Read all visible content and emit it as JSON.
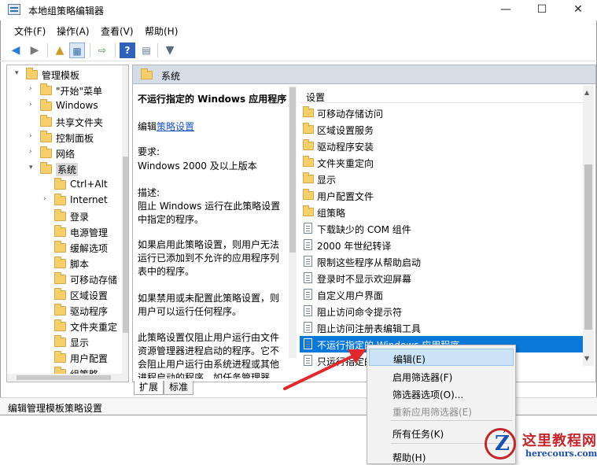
{
  "window": {
    "title": "本地组策略编辑器",
    "minimize_glyph": "—",
    "maximize_glyph": "☐",
    "close_glyph": "✕"
  },
  "menubar": [
    "文件(F)",
    "操作(A)",
    "查看(V)",
    "帮助(H)"
  ],
  "toolbar": {
    "icons": [
      "back-arrow-icon",
      "forward-arrow-icon",
      "up-folder-icon",
      "show-hide-tree-icon",
      "export-list-icon",
      "help-icon",
      "properties-icon",
      "filter-icon"
    ]
  },
  "tree": {
    "items": [
      {
        "label": "管理模板",
        "expand": "▾",
        "selected": false
      },
      {
        "label": "\"开始\"菜单",
        "expand": "›",
        "selected": false
      },
      {
        "label": "Windows",
        "expand": "›",
        "selected": false
      },
      {
        "label": "共享文件夹",
        "expand": "",
        "selected": false
      },
      {
        "label": "控制面板",
        "expand": "›",
        "selected": false
      },
      {
        "label": "网络",
        "expand": "›",
        "selected": false
      },
      {
        "label": "系统",
        "expand": "▾",
        "selected": true
      },
      {
        "label": "Ctrl+Alt",
        "expand": "",
        "selected": false
      },
      {
        "label": "Internet",
        "expand": "›",
        "selected": false
      },
      {
        "label": "登录",
        "expand": "",
        "selected": false
      },
      {
        "label": "电源管理",
        "expand": "",
        "selected": false
      },
      {
        "label": "缓解选项",
        "expand": "",
        "selected": false
      },
      {
        "label": "脚本",
        "expand": "",
        "selected": false
      },
      {
        "label": "可移动存储",
        "expand": "",
        "selected": false
      },
      {
        "label": "区域设置",
        "expand": "",
        "selected": false
      },
      {
        "label": "驱动程序",
        "expand": "",
        "selected": false
      },
      {
        "label": "文件夹重定向",
        "expand": "",
        "selected": false
      },
      {
        "label": "显示",
        "expand": "",
        "selected": false
      },
      {
        "label": "用户配置",
        "expand": "",
        "selected": false
      },
      {
        "label": "组策略",
        "expand": "",
        "selected": false
      }
    ]
  },
  "right": {
    "header": "系统",
    "desc": {
      "title": "不运行指定的 Windows 应用程序",
      "edit_prefix": "编辑",
      "edit_link": "策略设置",
      "req_label": "要求:",
      "req_value": "Windows 2000 及以上版本",
      "desc_label": "描述:",
      "desc_text": "阻止 Windows 运行在此策略设置中指定的程序。",
      "p1": "如果启用此策略设置，则用户无法运行已添加到不允许的应用程序列表中的程序。",
      "p2": "如果禁用或未配置此策略设置，则用户可以运行任何程序。",
      "p3": "此策略设置仅阻止用户运行由文件资源管理器进程启动的程序。它不会阻止用户运行由系统进程或其他进程启动的程序，如任务管理器。"
    },
    "list_header": "设置",
    "items": [
      {
        "label": "可移动存储访问",
        "kind": "folder"
      },
      {
        "label": "区域设置服务",
        "kind": "folder"
      },
      {
        "label": "驱动程序安装",
        "kind": "folder"
      },
      {
        "label": "文件夹重定向",
        "kind": "folder"
      },
      {
        "label": "显示",
        "kind": "folder"
      },
      {
        "label": "用户配置文件",
        "kind": "folder"
      },
      {
        "label": "组策略",
        "kind": "folder"
      },
      {
        "label": "下载缺少的 COM 组件",
        "kind": "setting"
      },
      {
        "label": "2000 年世纪转译",
        "kind": "setting"
      },
      {
        "label": "限制这些程序从帮助启动",
        "kind": "setting"
      },
      {
        "label": "登录时不显示欢迎屏幕",
        "kind": "setting"
      },
      {
        "label": "自定义用户界面",
        "kind": "setting"
      },
      {
        "label": "阻止访问命令提示符",
        "kind": "setting"
      },
      {
        "label": "阻止访问注册表编辑工具",
        "kind": "setting"
      },
      {
        "label": "不运行指定的 Windows 应用程序",
        "kind": "setting",
        "selected": true
      },
      {
        "label": "只运行指定的 Windows 应用程序",
        "kind": "setting"
      }
    ]
  },
  "tabs": [
    "扩展",
    "标准"
  ],
  "status": "编辑管理模板策略设置",
  "context_menu": {
    "items": [
      {
        "label": "编辑(E)",
        "state": "highlighted"
      },
      {
        "label": "启用筛选器(F)",
        "state": "normal"
      },
      {
        "label": "筛选器选项(O)...",
        "state": "normal"
      },
      {
        "label": "重新应用筛选器(E)",
        "state": "disabled"
      },
      {
        "label": "所有任务(K)",
        "state": "normal",
        "submenu": "›"
      },
      {
        "label": "帮助(H)",
        "state": "normal"
      }
    ]
  },
  "watermark": {
    "text": "这里教程网",
    "url": "herecours.com"
  },
  "colors": {
    "selection": "#0a78d7",
    "arrow": "#e0282e",
    "header_bg": "#d5dde7"
  }
}
